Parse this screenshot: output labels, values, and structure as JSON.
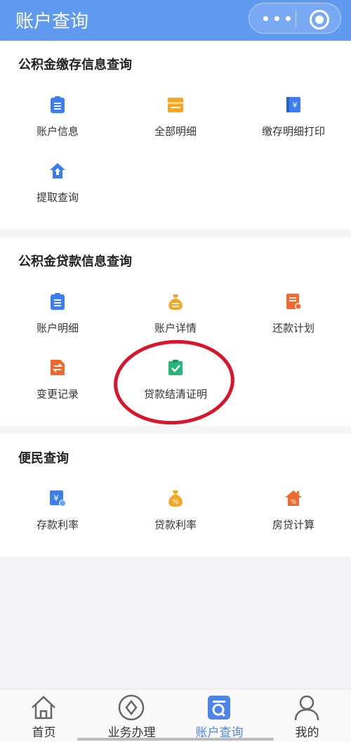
{
  "header": {
    "title": "账户查询",
    "more_icon": "more-dots-icon",
    "close_icon": "target-icon"
  },
  "sections": [
    {
      "title": "公积金缴存信息查询",
      "items": [
        {
          "label": "账户信息",
          "icon": "clipboard-icon",
          "color": "#3a7ef0"
        },
        {
          "label": "全部明细",
          "icon": "detail-card-icon",
          "color": "#f5a623"
        },
        {
          "label": "缴存明细打印",
          "icon": "yen-book-icon",
          "color": "#3a7ef0"
        },
        {
          "label": "提取查询",
          "icon": "upload-house-icon",
          "color": "#3a7ef0"
        }
      ]
    },
    {
      "title": "公积金贷款信息查询",
      "items": [
        {
          "label": "账户明细",
          "icon": "clipboard-icon",
          "color": "#3a7ef0"
        },
        {
          "label": "账户详情",
          "icon": "money-bag-icon",
          "color": "#f5a623"
        },
        {
          "label": "还款计划",
          "icon": "schedule-icon",
          "color": "#ee6a2e"
        },
        {
          "label": "变更记录",
          "icon": "change-record-icon",
          "color": "#ee6a2e"
        },
        {
          "label": "贷款结清证明",
          "icon": "check-clipboard-icon",
          "color": "#27b67a"
        }
      ]
    },
    {
      "title": "便民查询",
      "items": [
        {
          "label": "存款利率",
          "icon": "deposit-rate-icon",
          "color": "#3a7ef0"
        },
        {
          "label": "贷款利率",
          "icon": "loan-rate-icon",
          "color": "#f5a623"
        },
        {
          "label": "房贷计算",
          "icon": "house-calc-icon",
          "color": "#ee6a2e"
        }
      ]
    }
  ],
  "tabbar": [
    {
      "label": "首页",
      "icon": "home-icon",
      "active": false
    },
    {
      "label": "业务办理",
      "icon": "circle-business-icon",
      "active": false
    },
    {
      "label": "账户查询",
      "icon": "account-query-icon",
      "active": true
    },
    {
      "label": "我的",
      "icon": "user-icon",
      "active": false
    }
  ],
  "colors": {
    "header_bg": "#5f9af0",
    "active_tab": "#4c84e8",
    "highlight_circle": "#d8152a"
  }
}
